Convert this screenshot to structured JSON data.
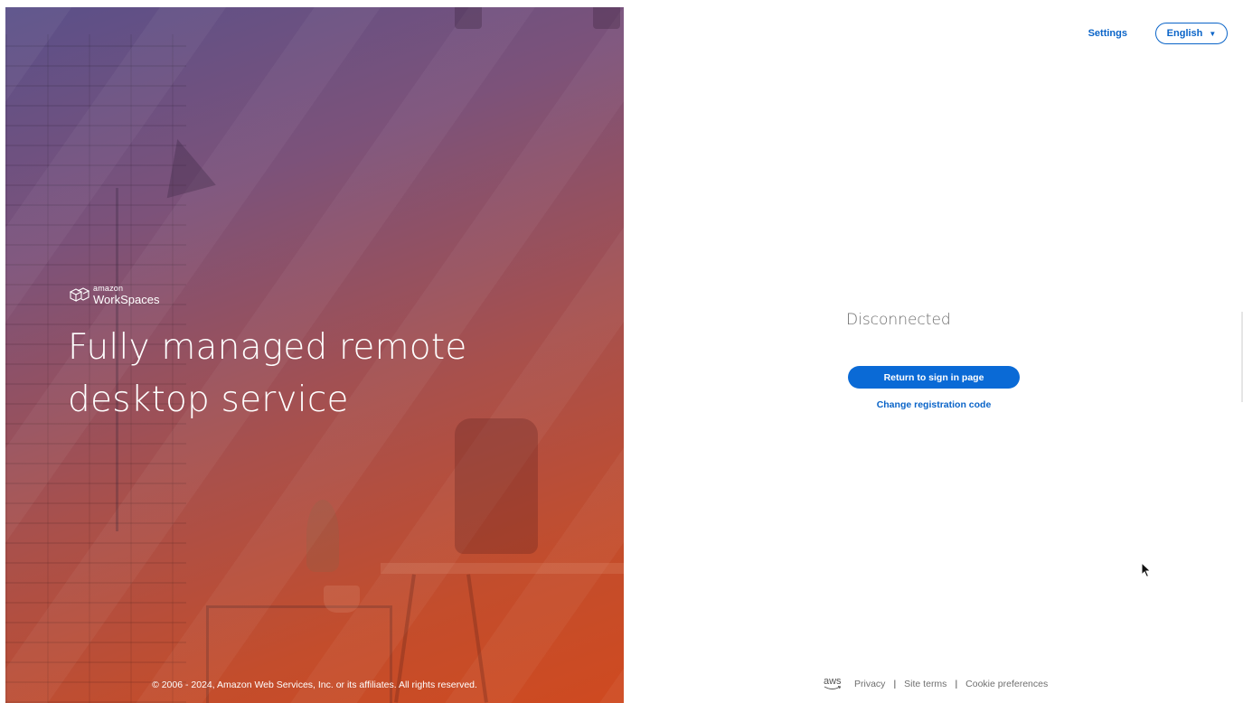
{
  "hero": {
    "brand_small": "amazon",
    "brand_big": "WorkSpaces",
    "headline_line1": "Fully managed remote",
    "headline_line2": "desktop service",
    "copyright": "© 2006 - 2024, Amazon Web Services, Inc. or its affiliates. All rights reserved."
  },
  "topbar": {
    "settings_label": "Settings",
    "language_label": "English",
    "language_icon": "caret-down-icon"
  },
  "main": {
    "status": "Disconnected",
    "primary_button": "Return to sign in page",
    "secondary_link": "Change registration code"
  },
  "footer": {
    "logo_text": "aws",
    "links": [
      "Privacy",
      "Site terms",
      "Cookie preferences"
    ],
    "separator": "|"
  },
  "colors": {
    "accent": "#0a64c8",
    "button": "#0a6ad6",
    "status_text": "#6b6b6b",
    "hero_gradient_top": "#5a5089",
    "hero_gradient_bottom": "#cf4a20"
  }
}
